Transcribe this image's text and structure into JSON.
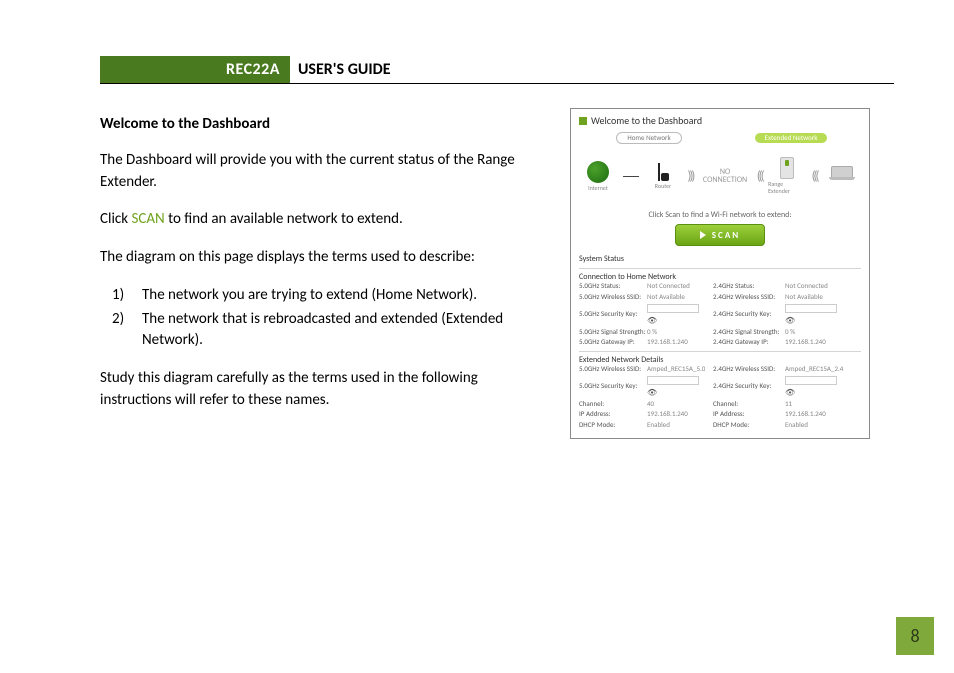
{
  "header": {
    "model": "REC22A",
    "guide_label": "USER'S GUIDE"
  },
  "body": {
    "welcome_heading": "Welcome to the Dashboard",
    "p1": "The Dashboard will provide you with the current status of the Range Extender.",
    "p2_pre": "Click ",
    "p2_scan": "SCAN",
    "p2_post": " to find an available network to extend.",
    "p3": "The diagram on this page displays the terms used to describe:",
    "li1": "The network you are trying to extend (Home Network).",
    "li2": "The network that is rebroadcasted and extended (Extended Network).",
    "p4": "Study this diagram carefully as the terms used in the following instructions will refer to these names."
  },
  "screenshot": {
    "title": "Welcome to the Dashboard",
    "zone_home": "Home Network",
    "zone_ext": "Extended Network",
    "dev_internet": "Internet",
    "dev_router": "Router",
    "dev_extender": "Range Extender",
    "no_connection_top": "NO",
    "no_connection_bottom": "CONNECTION",
    "scan_prompt": "Click Scan to find a Wi-Fi network to extend:",
    "scan_btn": "SCAN",
    "system_status": "System Status",
    "conn_heading": "Connection to Home Network",
    "ext_heading": "Extended Network Details",
    "conn": {
      "r1l": "5.0GHz Status:",
      "r1v": "Not Connected",
      "r1l2": "2.4GHz Status:",
      "r1v2": "Not Connected",
      "r2l": "5.0GHz Wireless SSID:",
      "r2v": "Not Available",
      "r2l2": "2.4GHz Wireless SSID:",
      "r2v2": "Not Available",
      "r3l": "5.0GHz Security Key:",
      "r3l2": "2.4GHz Security Key:",
      "r4l": "5.0GHz Signal Strength:",
      "r4v": "0 %",
      "r4l2": "2.4GHz Signal Strength:",
      "r4v2": "0 %",
      "r5l": "5.0GHz Gateway IP:",
      "r5v": "192.168.1.240",
      "r5l2": "2.4GHz Gateway IP:",
      "r5v2": "192.168.1.240"
    },
    "ext": {
      "r1l": "5.0GHz Wireless SSID:",
      "r1v": "Amped_REC15A_5.0",
      "r1l2": "2.4GHz Wireless SSID:",
      "r1v2": "Amped_REC15A_2.4",
      "r2l": "5.0GHz Security Key:",
      "r2l2": "2.4GHz Security Key:",
      "r3l": "Channel:",
      "r3v": "40",
      "r3l2": "Channel:",
      "r3v2": "11",
      "r4l": "IP Address:",
      "r4v": "192.168.1.240",
      "r4l2": "IP Address:",
      "r4v2": "192.168.1.240",
      "r5l": "DHCP Mode:",
      "r5v": "Enabled",
      "r5l2": "DHCP Mode:",
      "r5v2": "Enabled"
    }
  },
  "page_number": "8"
}
